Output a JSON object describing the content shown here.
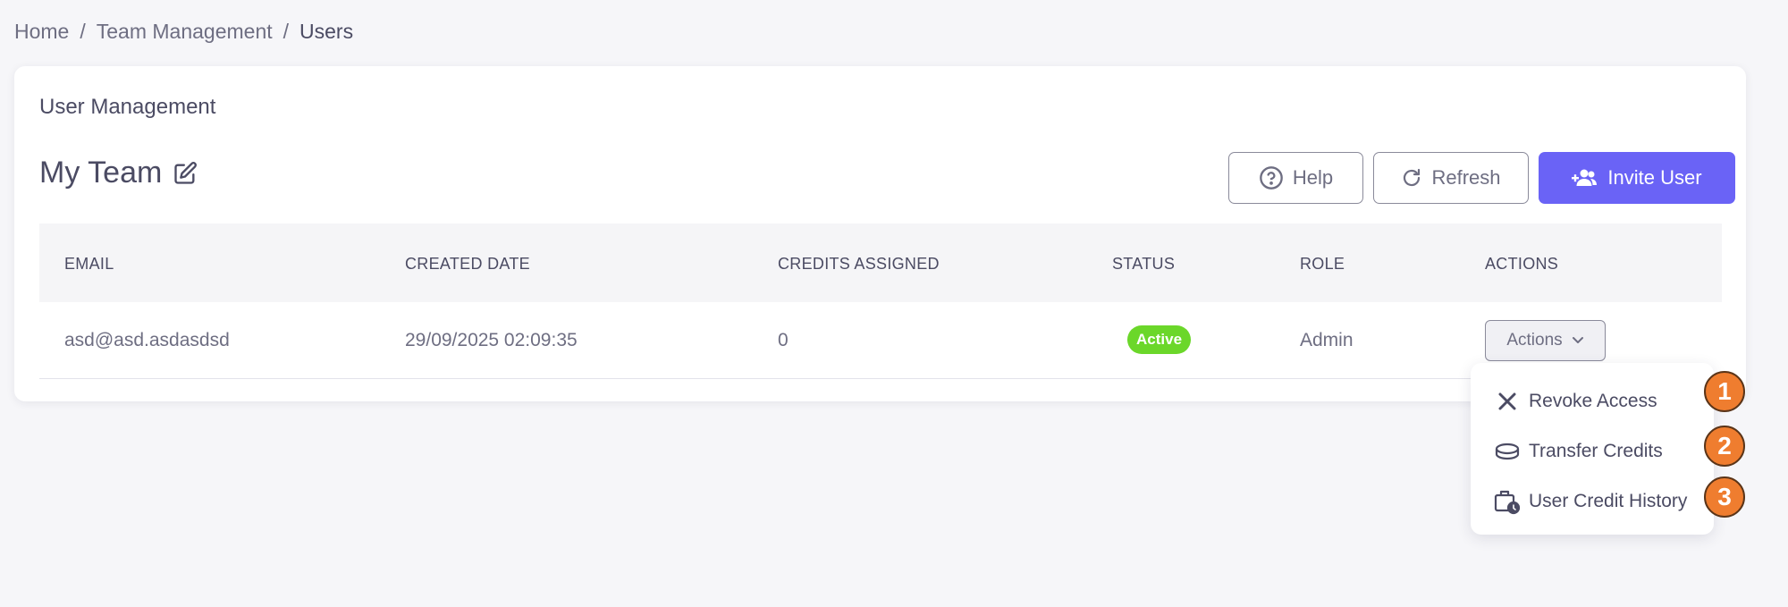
{
  "breadcrumb": {
    "home": "Home",
    "team_management": "Team Management",
    "users": "Users",
    "separator": "/"
  },
  "card": {
    "title": "User Management"
  },
  "team": {
    "name": "My Team"
  },
  "toolbar": {
    "help_label": "Help",
    "refresh_label": "Refresh",
    "invite_label": "Invite User"
  },
  "table": {
    "headers": {
      "email": "EMAIL",
      "created": "CREATED DATE",
      "credits": "CREDITS ASSIGNED",
      "status": "STATUS",
      "role": "ROLE",
      "actions": "ACTIONS"
    },
    "rows": [
      {
        "email": "asd@asd.asdasdsd",
        "created": "29/09/2025 02:09:35",
        "credits": "0",
        "status": "Active",
        "role": "Admin",
        "actions_label": "Actions"
      }
    ]
  },
  "menu": {
    "items": [
      {
        "label": "Revoke Access",
        "icon": "close-icon"
      },
      {
        "label": "Transfer Credits",
        "icon": "coins-icon"
      },
      {
        "label": "User Credit History",
        "icon": "briefcase-clock-icon"
      }
    ]
  },
  "markers": [
    "1",
    "2",
    "3"
  ],
  "colors": {
    "primary": "#6a63f6",
    "active_badge": "#6bd72a",
    "marker": "#ef7d2f"
  }
}
